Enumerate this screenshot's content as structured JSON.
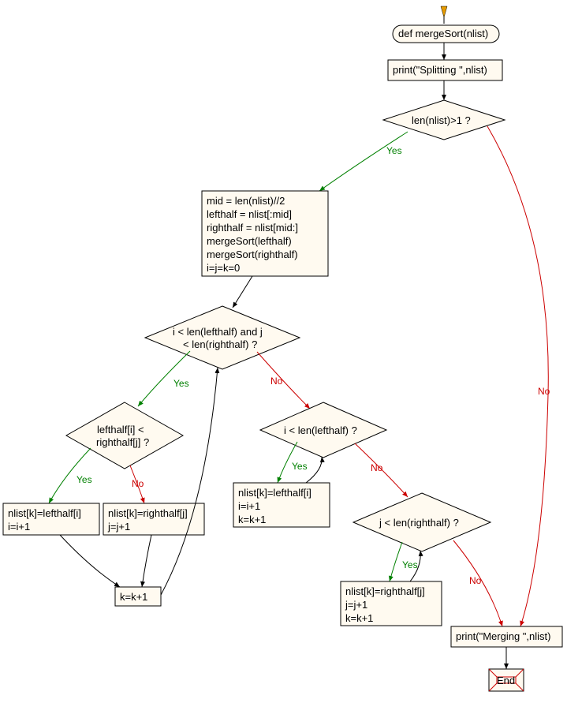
{
  "chart_data": {
    "type": "flowchart",
    "title": "mergeSort flowchart",
    "nodes": [
      {
        "id": "start",
        "shape": "arrow-entry",
        "label": ""
      },
      {
        "id": "func",
        "shape": "terminator",
        "label": "def mergeSort(nlist)"
      },
      {
        "id": "print_split",
        "shape": "process",
        "label": "print(\"Splitting \",nlist)"
      },
      {
        "id": "len_gt1",
        "shape": "decision",
        "label": "len(nlist)>1 ?"
      },
      {
        "id": "init_block",
        "shape": "process",
        "label": "mid = len(nlist)//2\nlefthalf = nlist[:mid]\nrighthalf = nlist[mid:]\nmergeSort(lefthalf)\nmergeSort(righthalf)\ni=j=k=0"
      },
      {
        "id": "while_ij",
        "shape": "decision",
        "label": "i < len(lefthalf) and j\n< len(righthalf) ?"
      },
      {
        "id": "cmp_lr",
        "shape": "decision",
        "label": "lefthalf[i] <\nrighthalf[j] ?"
      },
      {
        "id": "assign_left1",
        "shape": "process",
        "label": "nlist[k]=lefthalf[i]\ni=i+1"
      },
      {
        "id": "assign_right1",
        "shape": "process",
        "label": "nlist[k]=righthalf[j]\nj=j+1"
      },
      {
        "id": "k_inc",
        "shape": "process",
        "label": "k=k+1"
      },
      {
        "id": "while_i",
        "shape": "decision",
        "label": "i < len(lefthalf) ?"
      },
      {
        "id": "assign_left2",
        "shape": "process",
        "label": "nlist[k]=lefthalf[i]\ni=i+1\nk=k+1"
      },
      {
        "id": "while_j",
        "shape": "decision",
        "label": "j < len(righthalf) ?"
      },
      {
        "id": "assign_right2",
        "shape": "process",
        "label": "nlist[k]=righthalf[j]\nj=j+1\nk=k+1"
      },
      {
        "id": "print_merge",
        "shape": "process",
        "label": "print(\"Merging \",nlist)"
      },
      {
        "id": "end",
        "shape": "end",
        "label": "End"
      }
    ],
    "edges": [
      {
        "from": "start",
        "to": "func",
        "label": ""
      },
      {
        "from": "func",
        "to": "print_split",
        "label": ""
      },
      {
        "from": "print_split",
        "to": "len_gt1",
        "label": ""
      },
      {
        "from": "len_gt1",
        "to": "init_block",
        "label": "Yes"
      },
      {
        "from": "len_gt1",
        "to": "print_merge",
        "label": "No"
      },
      {
        "from": "init_block",
        "to": "while_ij",
        "label": ""
      },
      {
        "from": "while_ij",
        "to": "cmp_lr",
        "label": "Yes"
      },
      {
        "from": "while_ij",
        "to": "while_i",
        "label": "No"
      },
      {
        "from": "cmp_lr",
        "to": "assign_left1",
        "label": "Yes"
      },
      {
        "from": "cmp_lr",
        "to": "assign_right1",
        "label": "No"
      },
      {
        "from": "assign_left1",
        "to": "k_inc",
        "label": ""
      },
      {
        "from": "assign_right1",
        "to": "k_inc",
        "label": ""
      },
      {
        "from": "k_inc",
        "to": "while_ij",
        "label": ""
      },
      {
        "from": "while_i",
        "to": "assign_left2",
        "label": "Yes"
      },
      {
        "from": "assign_left2",
        "to": "while_i",
        "label": ""
      },
      {
        "from": "while_i",
        "to": "while_j",
        "label": "No"
      },
      {
        "from": "while_j",
        "to": "assign_right2",
        "label": "Yes"
      },
      {
        "from": "assign_right2",
        "to": "while_j",
        "label": ""
      },
      {
        "from": "while_j",
        "to": "print_merge",
        "label": "No"
      },
      {
        "from": "print_merge",
        "to": "end",
        "label": ""
      }
    ]
  },
  "labels": {
    "yes": "Yes",
    "no": "No"
  },
  "nodes": {
    "func": "def mergeSort(nlist)",
    "print_split": "print(\"Splitting \",nlist)",
    "len_gt1": "len(nlist)>1 ?",
    "init_line1": "mid = len(nlist)//2",
    "init_line2": "lefthalf = nlist[:mid]",
    "init_line3": "righthalf = nlist[mid:]",
    "init_line4": "mergeSort(lefthalf)",
    "init_line5": "mergeSort(righthalf)",
    "init_line6": "i=j=k=0",
    "while_ij_l1": "i < len(lefthalf) and j",
    "while_ij_l2": "< len(righthalf) ?",
    "cmp_lr_l1": "lefthalf[i] <",
    "cmp_lr_l2": "righthalf[j] ?",
    "assign_left1_l1": "nlist[k]=lefthalf[i]",
    "assign_left1_l2": "i=i+1",
    "assign_right1_l1": "nlist[k]=righthalf[j]",
    "assign_right1_l2": "j=j+1",
    "k_inc": "k=k+1",
    "while_i": "i < len(lefthalf) ?",
    "assign_left2_l1": "nlist[k]=lefthalf[i]",
    "assign_left2_l2": "i=i+1",
    "assign_left2_l3": "k=k+1",
    "while_j": "j < len(righthalf) ?",
    "assign_right2_l1": "nlist[k]=righthalf[j]",
    "assign_right2_l2": "j=j+1",
    "assign_right2_l3": "k=k+1",
    "print_merge": "print(\"Merging \",nlist)",
    "end": "End"
  }
}
